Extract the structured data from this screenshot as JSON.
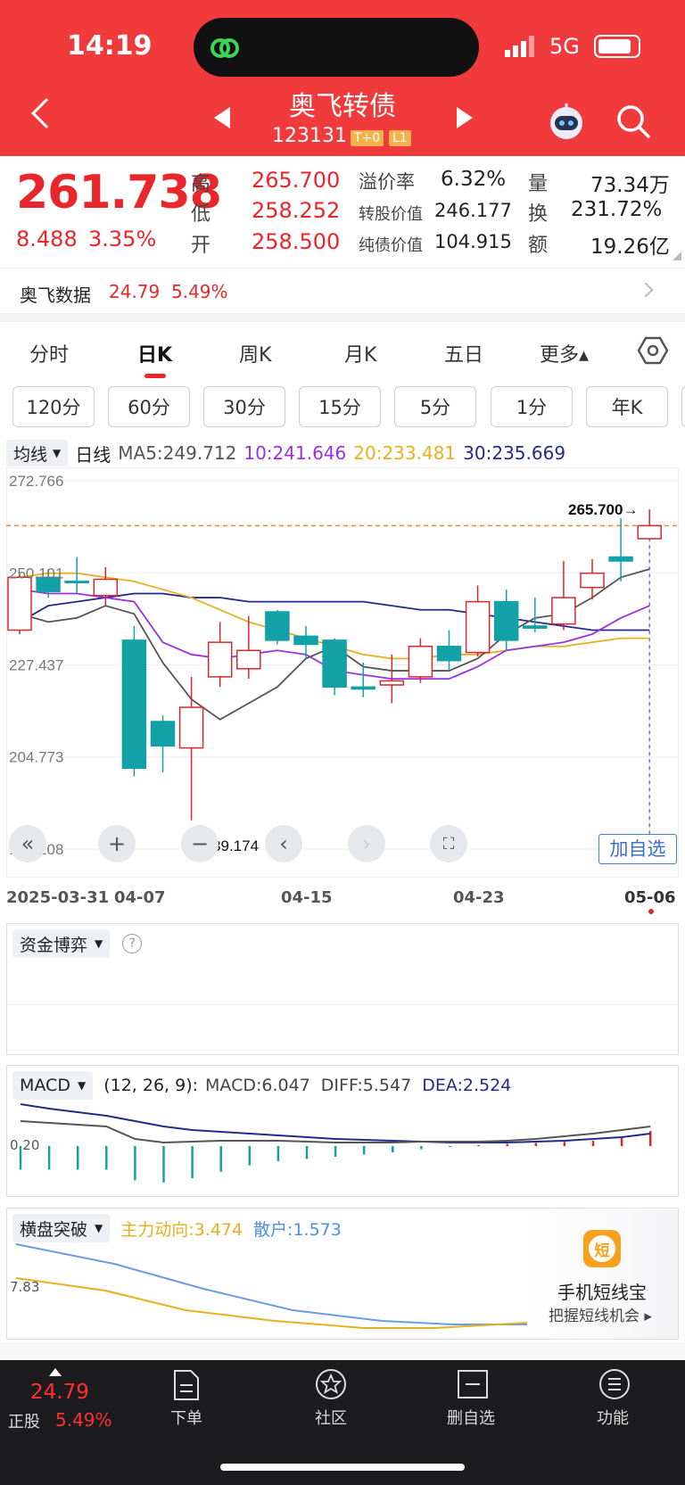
{
  "status": {
    "time": "14:19",
    "network": "5G"
  },
  "header": {
    "title": "奥飞转债",
    "code": "123131",
    "badge1": "T+0",
    "badge2": "L1"
  },
  "quote": {
    "price": "261.738",
    "change": "8.488",
    "change_pct": "3.35%",
    "high_label": "高",
    "high": "265.700",
    "low_label": "低",
    "low": "258.252",
    "open_label": "开",
    "open": "258.500",
    "premium_label": "溢价率",
    "premium": "6.32%",
    "conv_value_label": "转股价值",
    "conv_value": "246.177",
    "bond_value_label": "纯债价值",
    "bond_value": "104.915",
    "vol_label": "量",
    "vol": "73.34万",
    "turnover_label": "换",
    "turnover": "231.72%",
    "amount_label": "额",
    "amount": "19.26亿"
  },
  "underlying": {
    "name": "奥飞数据",
    "price": "24.79",
    "pct": "5.49%"
  },
  "tabs": [
    "分时",
    "日K",
    "周K",
    "月K",
    "五日",
    "更多▴"
  ],
  "active_tab": "日K",
  "periods": [
    "120分",
    "60分",
    "30分",
    "15分",
    "5分",
    "1分",
    "年K"
  ],
  "ma_line": {
    "selector": "均线",
    "label": "日线",
    "ma5": "MA5:249.712",
    "ma10": "10:241.646",
    "ma20": "20:233.481",
    "ma30": "30:235.669"
  },
  "colors": {
    "up": "#d9272e",
    "down": "#13a1a8",
    "ma5": "#555555",
    "ma10": "#9b30e0",
    "ma20": "#e8b020",
    "ma30": "#232a8c",
    "brand": "#f03a3c"
  },
  "chart_data": {
    "type": "candlestick",
    "yticks": [
      "272.766",
      "250.101",
      "227.437",
      "204.773",
      "182.108"
    ],
    "ylim": [
      182.108,
      272.766
    ],
    "x_labels": [
      "2025-03-31",
      "04-07",
      "04-15",
      "04-23",
      "05-06"
    ],
    "max_label": "265.700→",
    "min_label": "←189.174",
    "candles": [
      {
        "o": 236,
        "c": 249,
        "h": 250,
        "l": 235
      },
      {
        "o": 249,
        "c": 245.5,
        "h": 251,
        "l": 244
      },
      {
        "o": 248,
        "c": 247.8,
        "h": 254,
        "l": 245
      },
      {
        "o": 244.5,
        "c": 248.5,
        "h": 251.5,
        "l": 242
      },
      {
        "o": 233.5,
        "c": 202,
        "h": 237,
        "l": 200
      },
      {
        "o": 213.5,
        "c": 207.5,
        "h": 215,
        "l": 201
      },
      {
        "o": 207,
        "c": 217,
        "h": 224.5,
        "l": 189.174
      },
      {
        "o": 224.5,
        "c": 233,
        "h": 238,
        "l": 222
      },
      {
        "o": 226.5,
        "c": 231,
        "h": 239.5,
        "l": 224
      },
      {
        "o": 240.5,
        "c": 233.5,
        "h": 241,
        "l": 232.5
      },
      {
        "o": 234.5,
        "c": 232.5,
        "h": 237,
        "l": 229
      },
      {
        "o": 233.5,
        "c": 222,
        "h": 234,
        "l": 220
      },
      {
        "o": 222,
        "c": 221.5,
        "h": 228,
        "l": 219.5
      },
      {
        "o": 222.5,
        "c": 223.5,
        "h": 230,
        "l": 218
      },
      {
        "o": 224.5,
        "c": 232,
        "h": 234,
        "l": 223
      },
      {
        "o": 232,
        "c": 228.5,
        "h": 236,
        "l": 226
      },
      {
        "o": 230.5,
        "c": 243,
        "h": 247,
        "l": 229.5
      },
      {
        "o": 243,
        "c": 233.5,
        "h": 246,
        "l": 231
      },
      {
        "o": 237,
        "c": 236.5,
        "h": 244,
        "l": 235.5
      },
      {
        "o": 237.5,
        "c": 244,
        "h": 253,
        "l": 236
      },
      {
        "o": 246.5,
        "c": 250,
        "h": 253.5,
        "l": 243.5
      },
      {
        "o": 254,
        "c": 253,
        "h": 263.5,
        "l": 248
      },
      {
        "o": 258.5,
        "c": 261.7,
        "h": 265.7,
        "l": 258.25
      }
    ],
    "ma5": [
      240,
      238,
      239,
      242,
      240,
      228,
      219,
      214,
      218,
      222,
      229,
      232,
      227,
      226,
      226,
      226,
      229,
      235,
      239,
      240,
      244,
      249,
      251
    ],
    "ma10": [
      246,
      245,
      245,
      244,
      243,
      233,
      230,
      229,
      230,
      231,
      230,
      226,
      225,
      224,
      224,
      224,
      227,
      231,
      232,
      233,
      235,
      239,
      242
    ],
    "ma20": [
      249,
      250,
      250,
      249,
      248,
      246,
      244,
      241,
      238,
      236,
      234,
      232,
      230,
      229,
      229,
      230,
      230,
      231,
      232,
      232,
      233,
      234,
      234
    ],
    "ma30": [
      238,
      242,
      243,
      244,
      245,
      245,
      244,
      244,
      243,
      243,
      243,
      243,
      243,
      242,
      241,
      241,
      240,
      239,
      238,
      237,
      236,
      236,
      236
    ]
  },
  "controls": {
    "add_watch": "加自选"
  },
  "capital_panel": {
    "selector": "资金博弈"
  },
  "macd_panel": {
    "selector": "MACD",
    "params": "(12, 26, 9):",
    "macd": "MACD:6.047",
    "diff": "DIFF:5.547",
    "dea": "DEA:2.524",
    "ylabel": "0.20"
  },
  "hp_panel": {
    "selector": "横盘突破",
    "main": "主力动向:3.474",
    "retail": "散户:1.573",
    "ylabel": "7.83"
  },
  "promo": {
    "icon_char": "短",
    "title": "手机短线宝",
    "subtitle": "把握短线机会 ▸"
  },
  "bottom_nav": {
    "price": "24.79",
    "stock_label": "正股",
    "pct": "5.49%",
    "items": [
      "下单",
      "社区",
      "删自选",
      "功能"
    ]
  }
}
